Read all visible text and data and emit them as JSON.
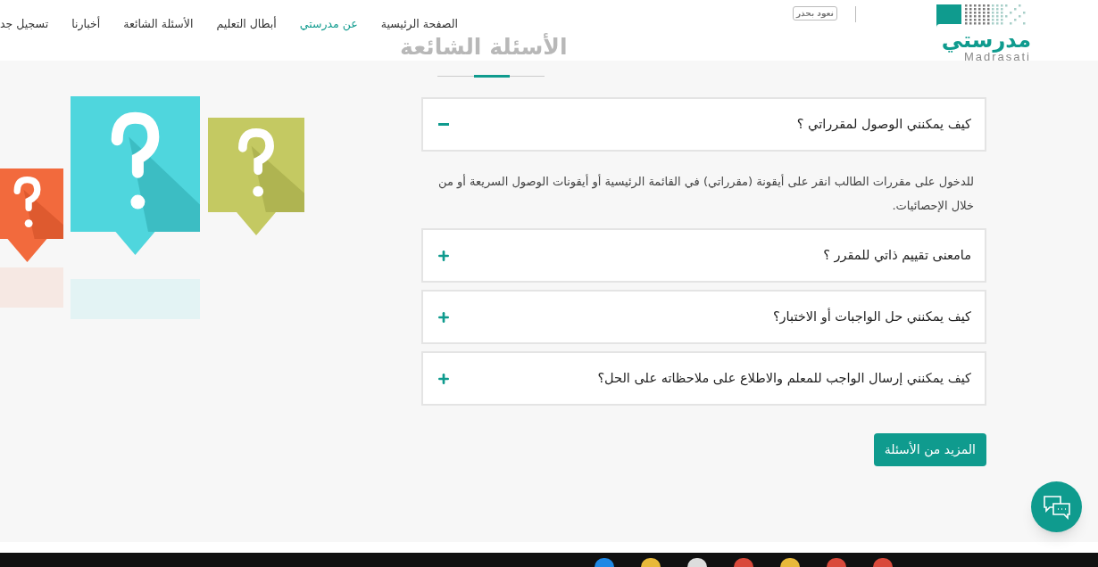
{
  "logo": {
    "arabic": "مدرستي",
    "latin": "Madrasati"
  },
  "badge": "نعود بحذر",
  "nav": [
    {
      "label": "الصفحة الرئيسية",
      "selected": false
    },
    {
      "label": "عن مدرستي",
      "selected": true
    },
    {
      "label": "أبطال التعليم",
      "selected": false
    },
    {
      "label": "الأسئلة الشائعة",
      "selected": false
    },
    {
      "label": "أخبارنا",
      "selected": false
    },
    {
      "label": "تسجيل جد",
      "selected": false
    }
  ],
  "page_title": "الأسئلة الشائعة",
  "faq": [
    {
      "question": "كيف يمكنني الوصول لمقرراتي ؟",
      "expanded": true,
      "answer": "للدخول على مقررات الطالب انقر على أيقونة (مقرراتي) في القائمة الرئيسية أو أيقونات الوصول السريعة أو من خلال الإحصائيات."
    },
    {
      "question": "مامعنى تقييم ذاتي للمقرر ؟",
      "expanded": false
    },
    {
      "question": "كيف يمكنني حل الواجبات أو الاختبار؟",
      "expanded": false
    },
    {
      "question": "كيف يمكنني إرسال الواجب للمعلم والاطلاع على ملاحظاته على الحل؟",
      "expanded": false
    }
  ],
  "more_button": "المزيد من الأسئلة"
}
